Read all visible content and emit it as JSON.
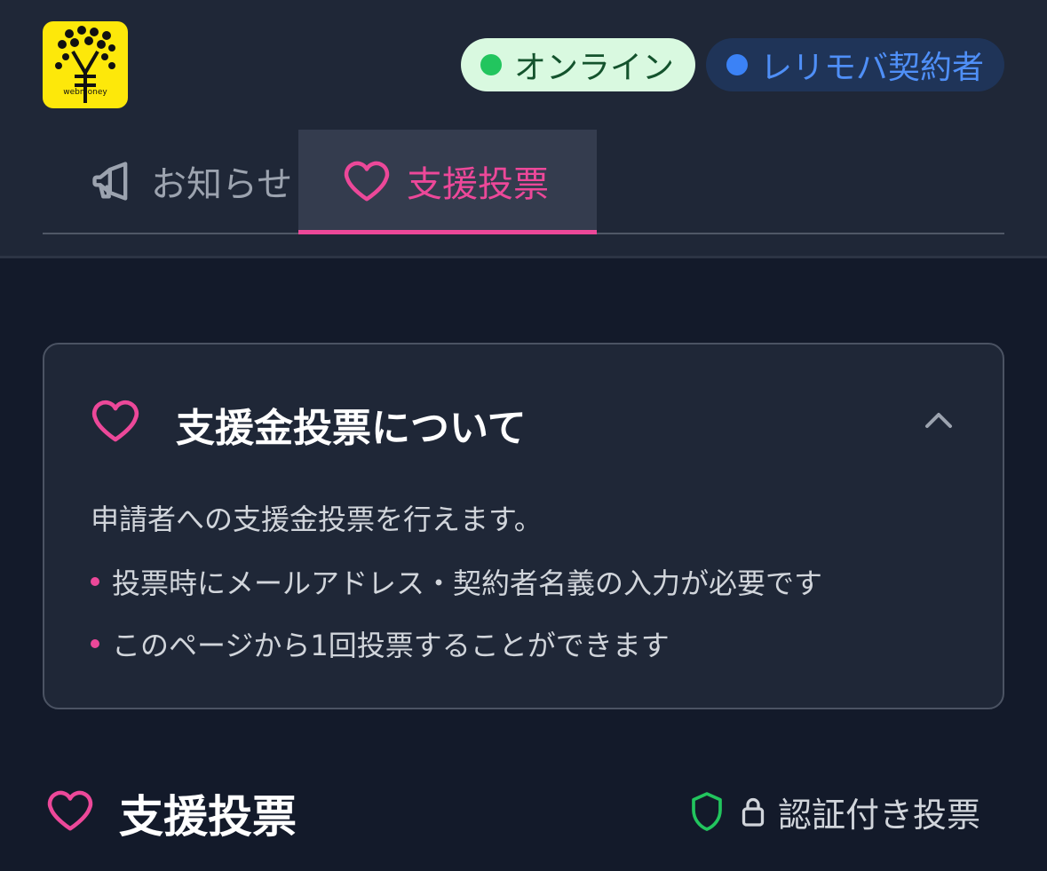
{
  "logo": {
    "text": "webmoney",
    "icon": "tree-yen-logo"
  },
  "status": {
    "online_label": "オンライン",
    "online_color": "#22c55e",
    "user_label": "レリモバ契約者",
    "user_color": "#3b82f6"
  },
  "tabs": [
    {
      "label": "お知らせ",
      "icon": "megaphone-icon",
      "active": false
    },
    {
      "label": "支援投票",
      "icon": "heart-icon",
      "active": true
    }
  ],
  "info_card": {
    "title": "支援金投票について",
    "icon": "heart-icon",
    "expanded": true,
    "description": "申請者への支援金投票を行えます。",
    "bullets": [
      "投票時にメールアドレス・契約者名義の入力が必要です",
      "このページから1回投票することができます"
    ]
  },
  "section": {
    "title": "支援投票",
    "icon": "heart-icon",
    "auth_label": "認証付き投票",
    "auth_icons": [
      "shield-icon",
      "lock-icon"
    ]
  },
  "colors": {
    "accent": "#ec4899",
    "background": "#131a2a",
    "panel": "#1f2737"
  }
}
